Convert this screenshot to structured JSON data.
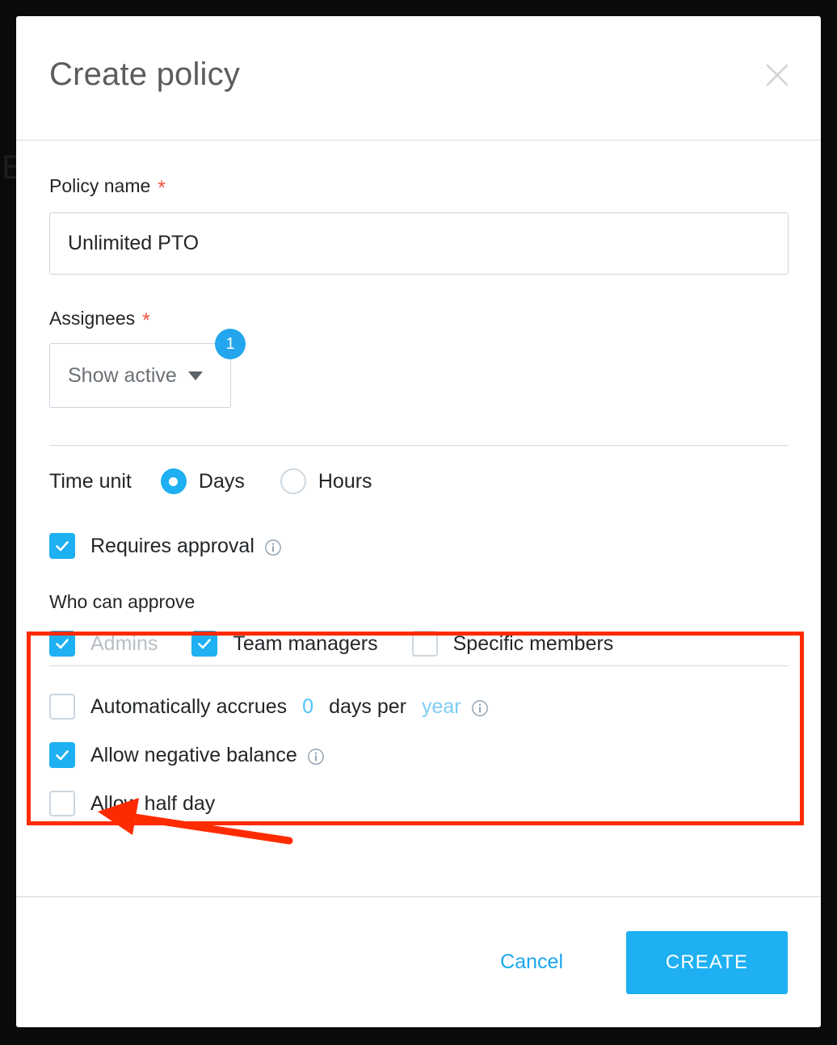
{
  "background": {
    "partial_text": "B"
  },
  "modal": {
    "title": "Create policy",
    "close_icon": "close-icon",
    "policy_name": {
      "label": "Policy name",
      "required_marker": "*",
      "value": "Unlimited PTO",
      "placeholder": ""
    },
    "assignees": {
      "label": "Assignees",
      "required_marker": "*",
      "selected": "Show active",
      "badge_count": "1"
    },
    "time_unit": {
      "label": "Time unit",
      "options": [
        {
          "label": "Days",
          "selected": true
        },
        {
          "label": "Hours",
          "selected": false
        }
      ]
    },
    "approval": {
      "requires_approval": {
        "label": "Requires approval",
        "checked": true,
        "info_icon": "info-icon"
      },
      "who_can_approve_label": "Who can approve",
      "approvers": [
        {
          "label": "Admins",
          "checked": true,
          "disabled": true
        },
        {
          "label": "Team managers",
          "checked": true,
          "disabled": false
        },
        {
          "label": "Specific members",
          "checked": false,
          "disabled": false
        }
      ]
    },
    "options": {
      "accrual": {
        "checked": false,
        "text_before": "Automatically accrues",
        "amount": "0",
        "text_middle": "days per",
        "period": "year",
        "info_icon": "info-icon"
      },
      "negative_balance": {
        "label": "Allow negative balance",
        "checked": true,
        "info_icon": "info-icon"
      },
      "half_day": {
        "label": "Allow half day",
        "checked": false
      }
    },
    "footer": {
      "cancel_label": "Cancel",
      "create_label": "CREATE"
    }
  },
  "annotations": {
    "highlight_color": "#ff2b00",
    "arrow_color": "#ff2b00"
  },
  "colors": {
    "accent": "#1eb0f2",
    "link": "#1ba7ee",
    "required": "#f4513c",
    "annotation": "#ff2b00"
  }
}
